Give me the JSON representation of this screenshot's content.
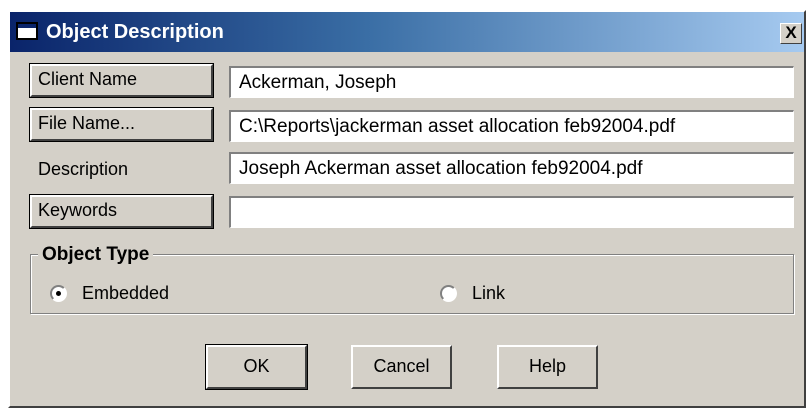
{
  "window": {
    "title": "Object Description",
    "close_label": "X",
    "icon": "window-icon"
  },
  "fields": {
    "client_name": {
      "button_label": "Client Name",
      "value": "Ackerman, Joseph"
    },
    "file_name": {
      "button_label": "File Name...",
      "value": "C:\\Reports\\jackerman asset allocation feb92004.pdf"
    },
    "description": {
      "label": "Description",
      "value": "Joseph Ackerman asset allocation feb92004.pdf"
    },
    "keywords": {
      "button_label": "Keywords",
      "value": ""
    }
  },
  "object_type": {
    "title": "Object Type",
    "options": [
      {
        "label": "Embedded",
        "selected": true
      },
      {
        "label": "Link",
        "selected": false
      }
    ]
  },
  "buttons": {
    "ok": "OK",
    "cancel": "Cancel",
    "help": "Help"
  },
  "colors": {
    "face": "#d4d0c8",
    "title_start": "#0a246a",
    "title_end": "#a6caf0"
  }
}
